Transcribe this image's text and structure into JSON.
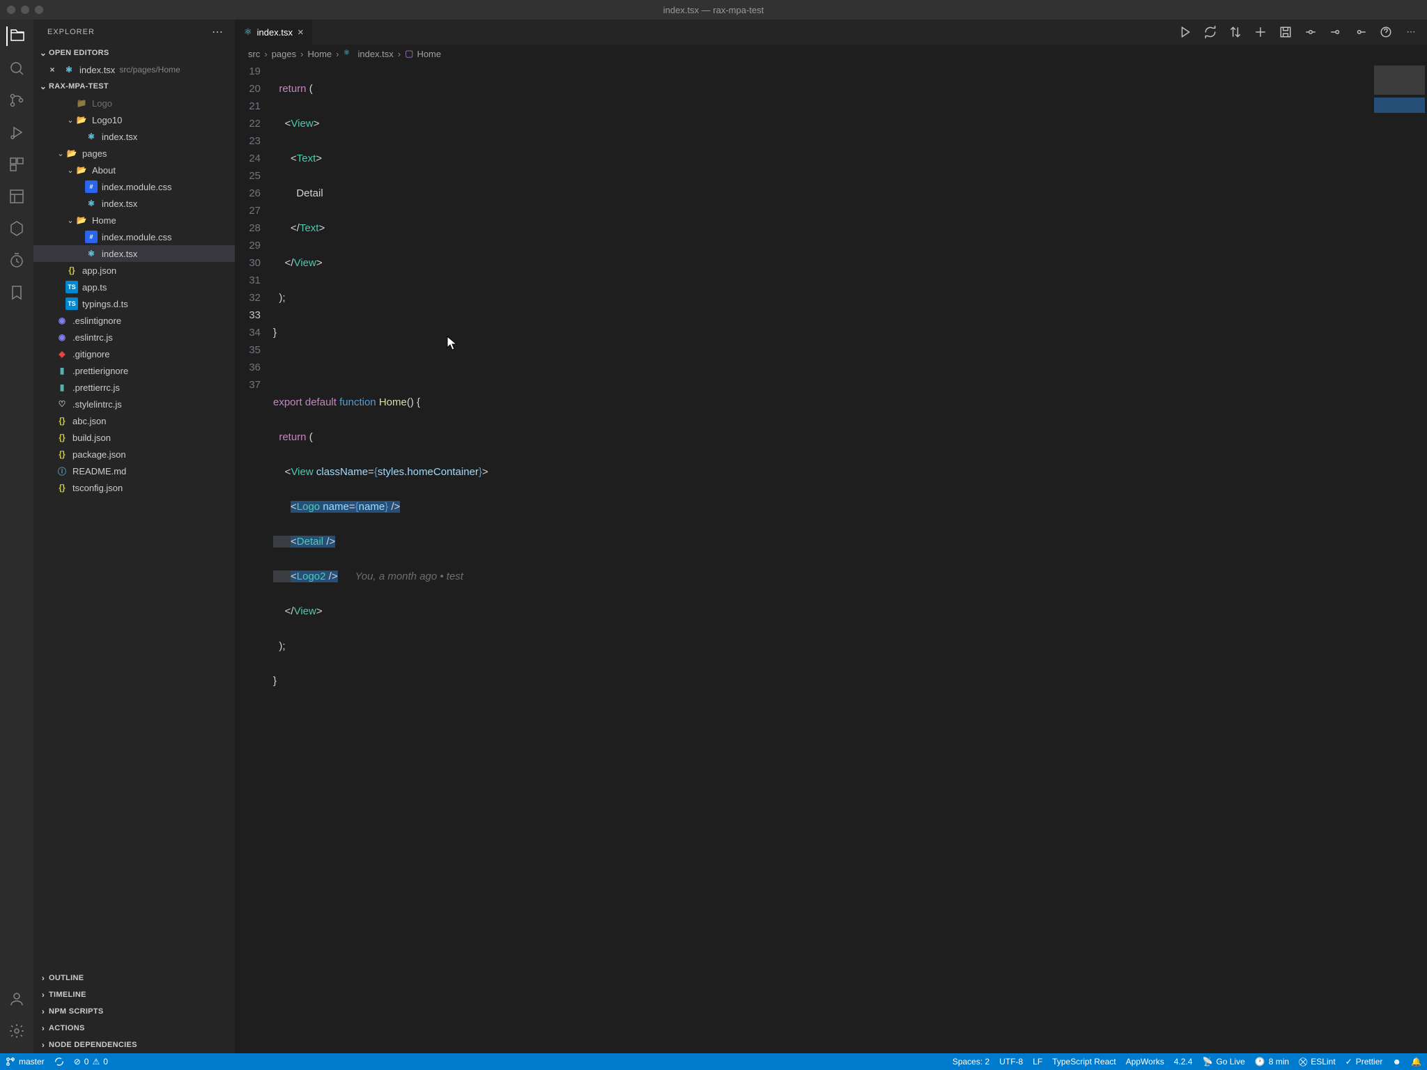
{
  "titlebar": {
    "title": "index.tsx — rax-mpa-test"
  },
  "sidebar": {
    "title": "EXPLORER",
    "sections": {
      "openEditors": "OPEN EDITORS",
      "project": "RAX-MPA-TEST",
      "outline": "OUTLINE",
      "timeline": "TIMELINE",
      "npmScripts": "NPM SCRIPTS",
      "actions": "ACTIONS",
      "nodeDependencies": "NODE DEPENDENCIES"
    },
    "openEditorItem": {
      "name": "index.tsx",
      "path": "src/pages/Home"
    },
    "tree": {
      "logo": "Logo",
      "logo10": "Logo10",
      "logo10_index": "index.tsx",
      "pages": "pages",
      "about": "About",
      "about_css": "index.module.css",
      "about_tsx": "index.tsx",
      "home": "Home",
      "home_css": "index.module.css",
      "home_tsx": "index.tsx",
      "appjson": "app.json",
      "appts": "app.ts",
      "typings": "typings.d.ts",
      "eslintignore": ".eslintignore",
      "eslintrc": ".eslintrc.js",
      "gitignore": ".gitignore",
      "prettierignore": ".prettierignore",
      "prettierrc": ".prettierrc.js",
      "stylelintrc": ".stylelintrc.js",
      "abcjson": "abc.json",
      "buildjson": "build.json",
      "packagejson": "package.json",
      "readme": "README.md",
      "tsconfig": "tsconfig.json"
    }
  },
  "tabs": {
    "active": "index.tsx"
  },
  "breadcrumb": [
    "src",
    "pages",
    "Home",
    "index.tsx",
    "Home"
  ],
  "editor": {
    "startLine": 19,
    "currentLine": 33,
    "blame": "You, a month ago • test",
    "code": {
      "return_open": "return (",
      "view_open": "<View>",
      "text_open": "<Text>",
      "detail_text": "Detail",
      "text_close": "</Text>",
      "view_close": "</View>",
      "return_close": ");",
      "brace_close": "}",
      "export_line": "export default function Home() {",
      "view_class": "<View className={styles.homeContainer}>",
      "logo_line": "<Logo name={name} />",
      "detail_comp": "<Detail />",
      "logo2_line": "<Logo2 />"
    }
  },
  "statusbar": {
    "branch": "master",
    "errors": "0",
    "warnings": "0",
    "spaces": "Spaces: 2",
    "encoding": "UTF-8",
    "eol": "LF",
    "language": "TypeScript React",
    "appworks": "AppWorks",
    "version": "4.2.4",
    "goLive": "Go Live",
    "timeUsed": "8 min",
    "eslint": "ESLint",
    "prettier": "Prettier"
  }
}
